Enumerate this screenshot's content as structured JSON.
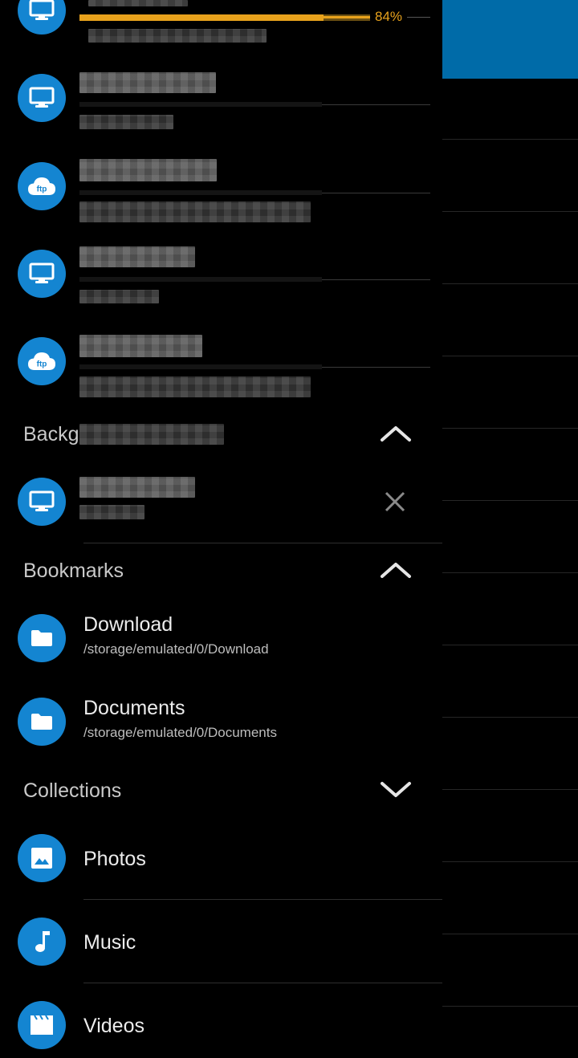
{
  "colors": {
    "accent_blue": "#1485d1",
    "toolbar_blue": "#006ba8",
    "progress_orange": "#e8a21c",
    "background": "#000000"
  },
  "remote": {
    "progress": {
      "percent_label": "84%",
      "value": 0.84
    },
    "connections": [
      {
        "icon": "monitor-icon",
        "type": "network"
      },
      {
        "icon": "monitor-icon",
        "type": "network"
      },
      {
        "icon": "ftp-cloud-icon",
        "type": "ftp",
        "icon_text": "ftp"
      },
      {
        "icon": "monitor-icon",
        "type": "network"
      },
      {
        "icon": "ftp-cloud-icon",
        "type": "ftp",
        "icon_text": "ftp"
      }
    ]
  },
  "background_section": {
    "header_label": "Backg",
    "toggle_icon": "chevron-up-icon",
    "item": {
      "icon": "monitor-icon",
      "action_icon": "close-icon"
    }
  },
  "bookmarks": {
    "header_label": "Bookmarks",
    "toggle_icon": "chevron-up-icon",
    "items": [
      {
        "title": "Download",
        "path": "/storage/emulated/0/Download",
        "icon": "folder-icon"
      },
      {
        "title": "Documents",
        "path": "/storage/emulated/0/Documents",
        "icon": "folder-icon"
      }
    ]
  },
  "collections": {
    "header_label": "Collections",
    "toggle_icon": "chevron-down-icon",
    "items": [
      {
        "title": "Photos",
        "icon": "image-icon"
      },
      {
        "title": "Music",
        "icon": "music-note-icon"
      },
      {
        "title": "Videos",
        "icon": "clapperboard-icon"
      }
    ]
  }
}
